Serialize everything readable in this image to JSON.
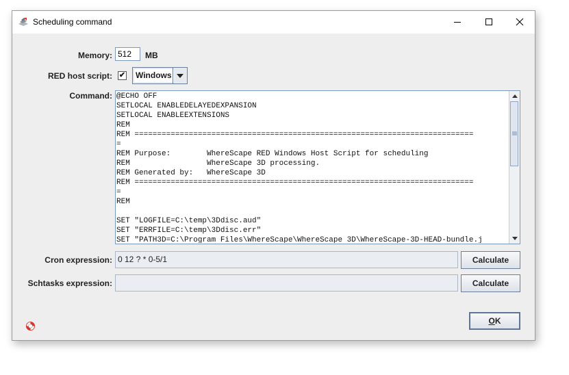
{
  "window": {
    "title": "Scheduling command"
  },
  "form": {
    "memory_label": "Memory:",
    "memory_value": "512",
    "memory_unit": "MB",
    "red_host_label": "RED host script:",
    "red_host_checked": true,
    "red_host_check_glyph": "✔",
    "os_select": "Windows",
    "command_label": "Command:",
    "command_text": "@ECHO OFF\nSETLOCAL ENABLEDELAYEDEXPANSION\nSETLOCAL ENABLEEXTENSIONS\nREM\nREM ===========================================================================\n=\nREM Purpose:        WhereScape RED Windows Host Script for scheduling\nREM                 WhereScape 3D processing.\nREM Generated by:   WhereScape 3D\nREM ===========================================================================\n=\nREM\n\nSET \"LOGFILE=C:\\temp\\3Ddisc.aud\"\nSET \"ERRFILE=C:\\temp\\3Ddisc.err\"\nSET \"PATH3D=C:\\Program Files\\WhereScape\\WhereScape 3D\\WhereScape-3D-HEAD-bundle.j",
    "cron_label": "Cron expression:",
    "cron_value": "0 12 ? * 0-5/1",
    "cron_calc_button": "Calculate",
    "schtasks_label": "Schtasks expression:",
    "schtasks_value": "",
    "schtasks_calc_button": "Calculate",
    "ok_prefix": "O",
    "ok_rest": "K"
  },
  "icons": {
    "app": "wherescape-app-icon",
    "minimize": "minimize-icon",
    "maximize": "maximize-icon",
    "close": "close-icon",
    "help": "lifebuoy-help-icon"
  },
  "colors": {
    "dialog_bg": "#eeeeee",
    "titlebar_bg": "#ffffff",
    "field_border": "#7a99b8",
    "help_red": "#d9342b"
  }
}
